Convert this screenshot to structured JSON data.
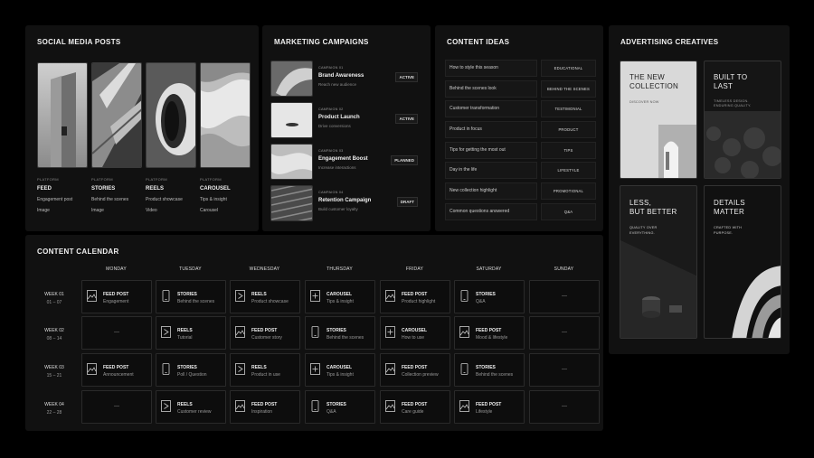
{
  "social": {
    "title": "SOCIAL MEDIA POSTS",
    "posts": [
      {
        "platform": "PLATFORM",
        "type": "FEED",
        "desc": "Engagement post",
        "format": "Image"
      },
      {
        "platform": "PLATFORM",
        "type": "STORIES",
        "desc": "Behind the scenes",
        "format": "Image"
      },
      {
        "platform": "PLATFORM",
        "type": "REELS",
        "desc": "Product showcase",
        "format": "Video"
      },
      {
        "platform": "PLATFORM",
        "type": "CAROUSEL",
        "desc": "Tips & insight",
        "format": "Carousel"
      }
    ]
  },
  "marketing": {
    "title": "MARKETING CAMPAIGNS",
    "campaigns": [
      {
        "num": "CAMPAIGN 01",
        "name": "Brand Awareness",
        "desc": "Reach new audience",
        "status": "ACTIVE"
      },
      {
        "num": "CAMPAIGN 02",
        "name": "Product Launch",
        "desc": "Drive conversions",
        "status": "ACTIVE"
      },
      {
        "num": "CAMPAIGN 03",
        "name": "Engagement Boost",
        "desc": "Increase interactions",
        "status": "PLANNED"
      },
      {
        "num": "CAMPAIGN 04",
        "name": "Retention Campaign",
        "desc": "Build customer loyalty",
        "status": "DRAFT"
      }
    ]
  },
  "ideas": {
    "title": "CONTENT IDEAS",
    "items": [
      {
        "idea": "How to style this season",
        "tag": "EDUCATIONAL"
      },
      {
        "idea": "Behind the scenes look",
        "tag": "BEHIND THE SCENES"
      },
      {
        "idea": "Customer transformation",
        "tag": "TESTIMONIAL"
      },
      {
        "idea": "Product in focus",
        "tag": "PRODUCT"
      },
      {
        "idea": "Tips for getting the most out",
        "tag": "TIPS"
      },
      {
        "idea": "Day in the life",
        "tag": "LIFESTYLE"
      },
      {
        "idea": "New collection highlight",
        "tag": "PROMOTIONAL"
      },
      {
        "idea": "Common questions answered",
        "tag": "Q&A"
      }
    ]
  },
  "ads": {
    "title": "ADVERTISING CREATIVES",
    "creatives": [
      {
        "headline1": "THE NEW",
        "headline2": "COLLECTION",
        "sub1": "DISCOVER NOW",
        "sub2": ""
      },
      {
        "headline1": "BUILT TO",
        "headline2": "LAST",
        "sub1": "TIMELESS DESIGN.",
        "sub2": "ENDURING QUALITY."
      },
      {
        "headline1": "LESS,",
        "headline2": "BUT BETTER",
        "sub1": "QUALITY OVER",
        "sub2": "EVERYTHING."
      },
      {
        "headline1": "DETAILS",
        "headline2": "MATTER",
        "sub1": "CRAFTED WITH",
        "sub2": "PURPOSE."
      }
    ]
  },
  "calendar": {
    "title": "CONTENT CALENDAR",
    "days": [
      "MONDAY",
      "TUESDAY",
      "WEDNESDAY",
      "THURSDAY",
      "FRIDAY",
      "SATURDAY",
      "SUNDAY"
    ],
    "weeks": [
      {
        "label": "WEEK 01",
        "dates": "01 – 07",
        "cells": [
          {
            "icon": "image",
            "type": "FEED POST",
            "desc": "Engagement"
          },
          {
            "icon": "phone",
            "type": "STORIES",
            "desc": "Behind the scenes"
          },
          {
            "icon": "play",
            "type": "REELS",
            "desc": "Product showcase"
          },
          {
            "icon": "plus",
            "type": "CAROUSEL",
            "desc": "Tips & insight"
          },
          {
            "icon": "image",
            "type": "FEED POST",
            "desc": "Product highlight"
          },
          {
            "icon": "phone",
            "type": "STORIES",
            "desc": "Q&A"
          },
          {
            "empty": "—"
          }
        ]
      },
      {
        "label": "WEEK 02",
        "dates": "08 – 14",
        "cells": [
          {
            "empty": "—"
          },
          {
            "icon": "play",
            "type": "REELS",
            "desc": "Tutorial"
          },
          {
            "icon": "image",
            "type": "FEED POST",
            "desc": "Customer story"
          },
          {
            "icon": "phone",
            "type": "STORIES",
            "desc": "Behind the scenes"
          },
          {
            "icon": "plus",
            "type": "CAROUSEL",
            "desc": "How to use"
          },
          {
            "icon": "image",
            "type": "FEED POST",
            "desc": "Mood & lifestyle"
          },
          {
            "empty": "—"
          }
        ]
      },
      {
        "label": "WEEK 03",
        "dates": "15 – 21",
        "cells": [
          {
            "icon": "image",
            "type": "FEED POST",
            "desc": "Announcement"
          },
          {
            "icon": "phone",
            "type": "STORIES",
            "desc": "Poll / Question"
          },
          {
            "icon": "play",
            "type": "REELS",
            "desc": "Product in use"
          },
          {
            "icon": "plus",
            "type": "CAROUSEL",
            "desc": "Tips & insight"
          },
          {
            "icon": "image",
            "type": "FEED POST",
            "desc": "Collection preview"
          },
          {
            "icon": "phone",
            "type": "STORIES",
            "desc": "Behind the scenes"
          },
          {
            "empty": "—"
          }
        ]
      },
      {
        "label": "WEEK 04",
        "dates": "22 – 28",
        "cells": [
          {
            "empty": "—"
          },
          {
            "icon": "play",
            "type": "REELS",
            "desc": "Customer review"
          },
          {
            "icon": "image",
            "type": "FEED POST",
            "desc": "Inspiration"
          },
          {
            "icon": "phone",
            "type": "STORIES",
            "desc": "Q&A"
          },
          {
            "icon": "image",
            "type": "FEED POST",
            "desc": "Care guide"
          },
          {
            "icon": "image",
            "type": "FEED POST",
            "desc": "Lifestyle"
          },
          {
            "empty": "—"
          }
        ]
      }
    ]
  }
}
